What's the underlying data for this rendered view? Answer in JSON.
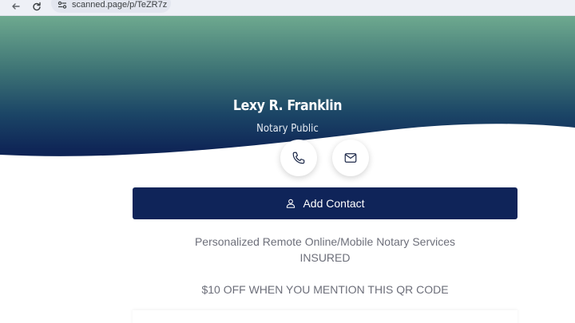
{
  "browser": {
    "url": "scanned.page/p/TeZR7z"
  },
  "profile": {
    "name": "Lexy R. Franklin",
    "title": "Notary Public"
  },
  "actions": {
    "add_contact_label": "Add Contact"
  },
  "description": {
    "line1": "Personalized Remote Online/Mobile Notary Services",
    "line2": "INSURED",
    "promo": "$10 OFF WHEN YOU MENTION THIS QR CODE"
  },
  "colors": {
    "hero_top": "#6ea98f",
    "hero_bottom": "#0d2050",
    "button_bg": "#0f2459",
    "text_muted": "#6d6f7a"
  },
  "icons": {
    "phone": "phone-icon",
    "mail": "mail-icon",
    "contact": "person-icon"
  }
}
